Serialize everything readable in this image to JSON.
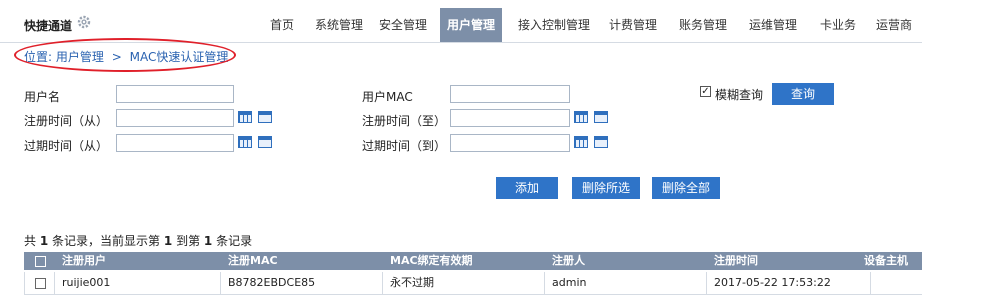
{
  "topbar": {
    "quick_label": "快捷通道",
    "nav": [
      "首页",
      "系统管理",
      "安全管理",
      "用户管理",
      "接入控制管理",
      "计费管理",
      "账务管理",
      "运维管理",
      "卡业务",
      "运营商"
    ],
    "active": "用户管理"
  },
  "breadcrumb": {
    "prefix": "位置:",
    "level1": "用户管理",
    "separator": ">",
    "level2": "MAC快速认证管理"
  },
  "form": {
    "username_label": "用户名",
    "username_value": "",
    "mac_label": "用户MAC",
    "mac_value": "",
    "fuzzy_label": "模糊查询",
    "fuzzy_checked": true,
    "search_button": "查询",
    "reg_from_label": "注册时间（从）",
    "reg_from_value": "",
    "reg_to_label": "注册时间（至）",
    "reg_to_value": "",
    "exp_from_label": "过期时间（从）",
    "exp_from_value": "",
    "exp_to_label": "过期时间（到）",
    "exp_to_value": ""
  },
  "actions": {
    "add": "添加",
    "delete_selected": "删除所选",
    "delete_all": "删除全部"
  },
  "records": {
    "p1": "共",
    "total": "1",
    "p2": "条记录，当前显示第",
    "from": "1",
    "p3": "到第",
    "to": "1",
    "p4": "条记录"
  },
  "table": {
    "headers": [
      "注册用户",
      "注册MAC",
      "MAC绑定有效期",
      "注册人",
      "注册时间",
      "设备主机"
    ],
    "rows": [
      [
        "ruijie001",
        "B8782EBDCE85",
        "永不过期",
        "admin",
        "2017-05-22 17:53:22",
        ""
      ]
    ]
  },
  "colors": {
    "nav_active": "#7d8fa8",
    "table_header": "#7d8fa8",
    "button": "#2f74c8",
    "link": "#2a62b0",
    "annotation": "#e0202a"
  }
}
